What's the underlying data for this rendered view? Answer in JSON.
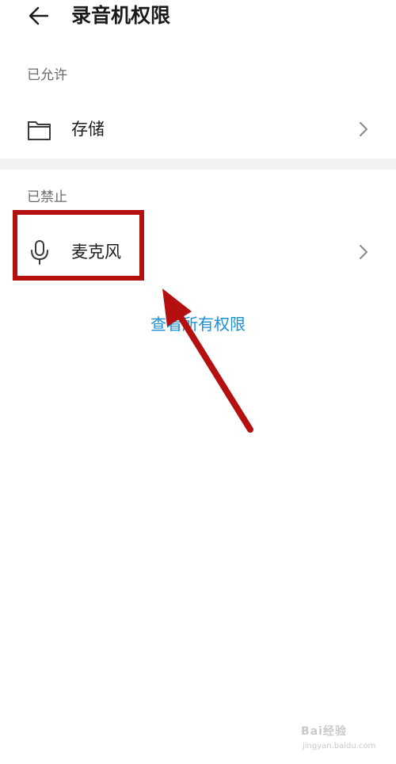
{
  "header": {
    "title": "录音机权限",
    "back_icon": "arrow-left-icon"
  },
  "sections": {
    "allowed": {
      "label": "已允许",
      "item": {
        "label": "存储",
        "icon": "folder-icon"
      }
    },
    "denied": {
      "label": "已禁止",
      "item": {
        "label": "麦克风",
        "icon": "microphone-icon"
      }
    }
  },
  "view_all_link": "查看所有权限",
  "annotation": {
    "highlight_color": "#b3100f"
  },
  "watermark": {
    "logo": "Bai经验",
    "url": "jingyan.baidu.com"
  },
  "colors": {
    "link": "#1a8fd6",
    "section_band": "#f2f2f2",
    "annotation": "#b3100f"
  }
}
